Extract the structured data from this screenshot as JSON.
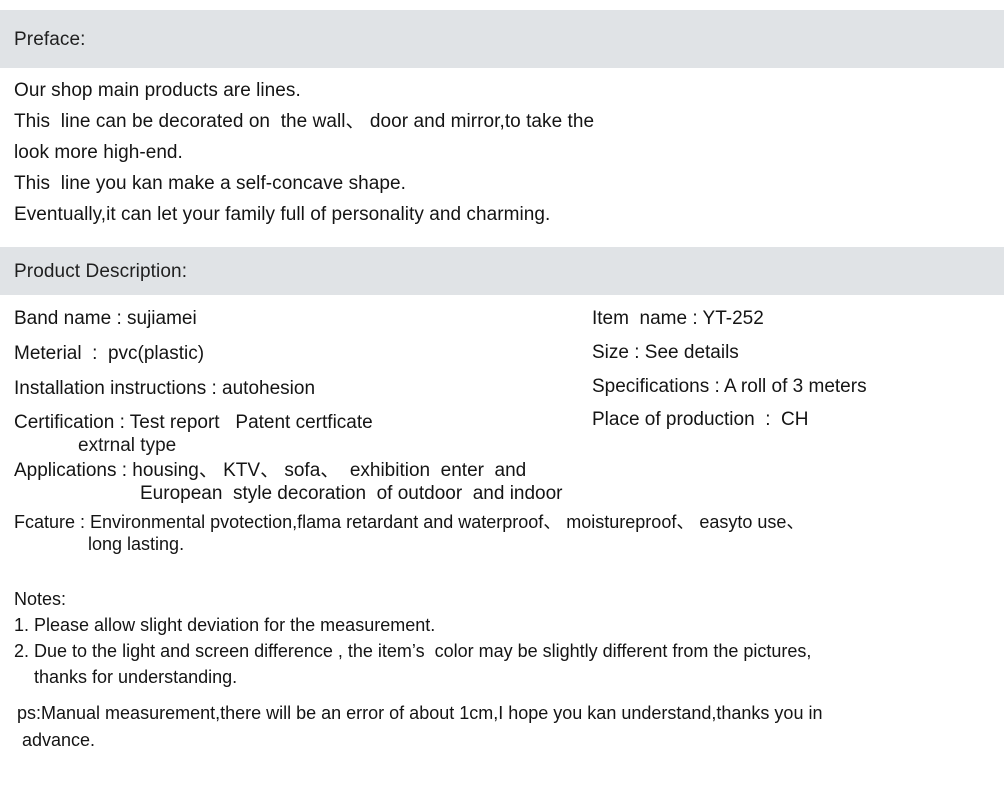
{
  "document": {
    "background_color": "#ffffff",
    "band_color": "#e0e3e6",
    "text_color": "#141414"
  },
  "preface": {
    "heading": "Preface:",
    "lines": [
      "Our shop main products are lines.",
      "This  line can be decorated on  the wall、 door and mirror,to take the",
      "look more high-end.",
      "This  line you kan make a self-concave shape.",
      "Eventually,it can let your family full of personality and charming."
    ]
  },
  "product_description": {
    "heading": "Product Description:",
    "left_column": [
      "Band name : sujiamei",
      "Meterial  :  pvc(plastic)",
      "Installation instructions : autohesion",
      "Certification : Test report   Patent certficate"
    ],
    "certification_subline": "extrnal type",
    "right_column": [
      "Item  name : YT-252",
      "Size : See details",
      "Specifications : A roll of 3 meters",
      "Place of production  :  CH"
    ],
    "applications": {
      "line1": "Applications : housing、 KTV、 sofa、  exhibition  enter  and",
      "line2": "European  style decoration  of outdoor  and indoor"
    },
    "fcature": {
      "line1": "Fcature : Environmental pvotection,flama retardant and waterproof、 moistureproof、 easyto use、",
      "line2": "long lasting."
    }
  },
  "notes": {
    "heading": "Notes:",
    "items": [
      "1. Please allow slight deviation for the measurement.",
      "2. Due to the light and screen difference , the item’s  color may be slightly different from the pictures,",
      "    thanks for understanding."
    ],
    "ps": {
      "line1": "ps:Manual measurement,there will be an error of about 1cm,I hope you kan understand,thanks you in",
      "line2": " advance."
    }
  }
}
